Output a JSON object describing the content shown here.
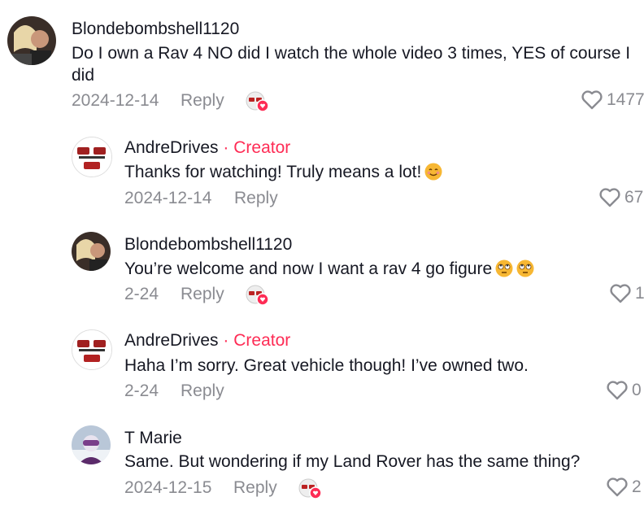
{
  "comments": [
    {
      "username": "Blondebombshell1120",
      "text": "Do I own a Rav 4 NO did I watch the whole video 3 times, YES of course I did",
      "date": "2024-12-14",
      "reply": "Reply",
      "likes": "1477",
      "creator_liked": true
    },
    {
      "username": "AndreDrives",
      "separator": "·",
      "badge": "Creator",
      "text": "Thanks for watching! Truly means a lot!",
      "emoji": "smiling-face",
      "date": "2024-12-14",
      "reply": "Reply",
      "likes": "67"
    },
    {
      "username": "Blondebombshell1120",
      "text": "You’re welcome and now I want a rav 4 go figure",
      "emoji": "eye-roll-face",
      "date": "2-24",
      "reply": "Reply",
      "likes": "1",
      "creator_liked": true
    },
    {
      "username": "AndreDrives",
      "separator": "·",
      "badge": "Creator",
      "text": "Haha I’m sorry. Great vehicle though! I’ve owned two.",
      "date": "2-24",
      "reply": "Reply",
      "likes": "0"
    },
    {
      "username": "T Marie",
      "text": "Same. But wondering if my Land Rover has the same thing?",
      "date": "2024-12-15",
      "reply": "Reply",
      "likes": "2",
      "creator_liked": true
    }
  ],
  "colors": {
    "accent": "#fe2c55",
    "muted": "#8a8b91",
    "text": "#161823"
  }
}
